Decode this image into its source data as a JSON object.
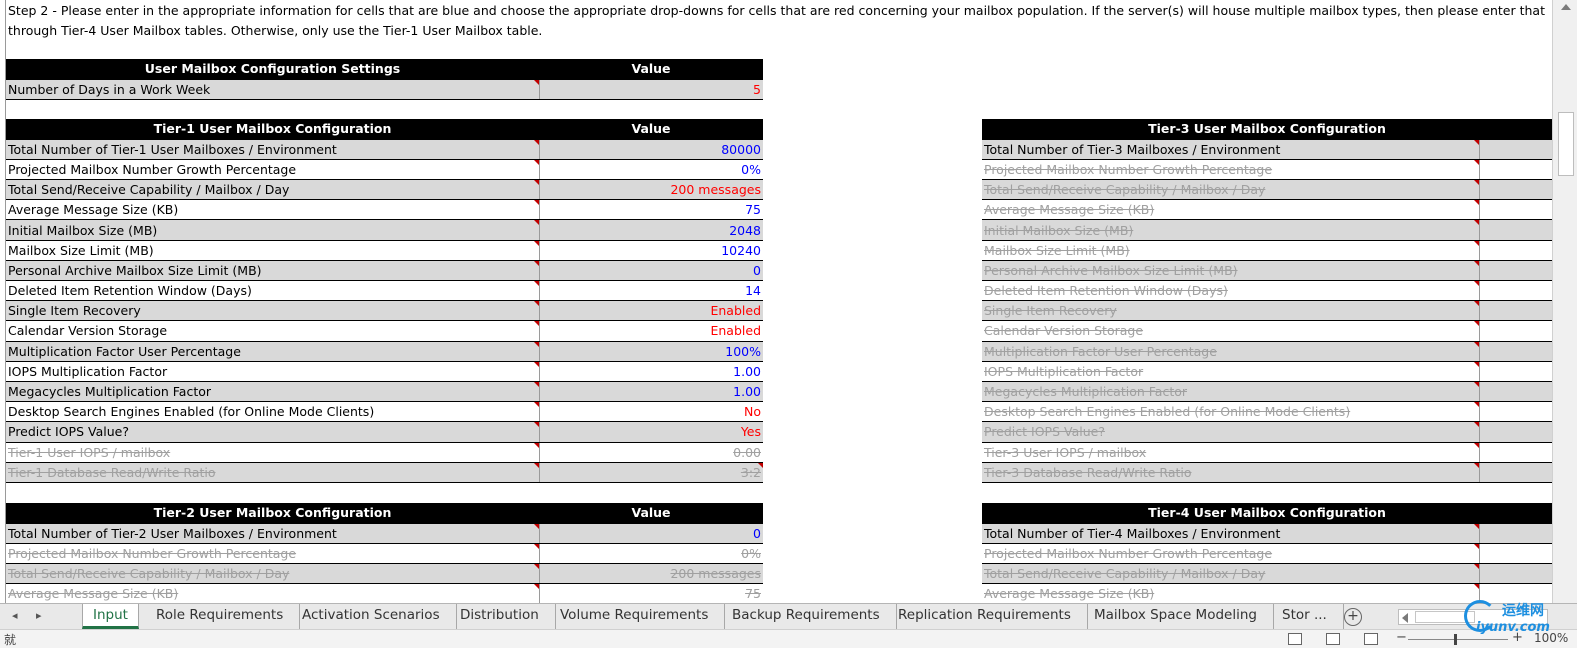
{
  "instructions": {
    "line1": "Step 2 - Please enter in the appropriate information for cells that are blue and choose the appropriate drop-downs for cells that are red concerning your mailbox population.  If the server(s) will house multiple mailbox types, then please enter that information",
    "line2": "through Tier-4 User Mailbox tables.  Otherwise, only use the Tier-1 User Mailbox table."
  },
  "settings": {
    "header": "User Mailbox Configuration Settings",
    "value_header": "Value",
    "rows": [
      {
        "label": "Number of Days in a Work Week",
        "value": "5",
        "color": "red"
      }
    ]
  },
  "tier1": {
    "header": "Tier-1 User Mailbox Configuration",
    "value_header": "Value",
    "rows": [
      {
        "label": "Total Number of Tier-1 User Mailboxes / Environment",
        "value": "80000",
        "color": "blue"
      },
      {
        "label": "Projected Mailbox Number Growth Percentage",
        "value": "0%",
        "color": "blue"
      },
      {
        "label": "Total Send/Receive Capability / Mailbox / Day",
        "value": "200 messages",
        "color": "red"
      },
      {
        "label": "Average Message Size (KB)",
        "value": "75",
        "color": "blue"
      },
      {
        "label": "Initial Mailbox Size (MB)",
        "value": "2048",
        "color": "blue"
      },
      {
        "label": "Mailbox Size Limit (MB)",
        "value": "10240",
        "color": "blue"
      },
      {
        "label": "Personal Archive Mailbox Size Limit (MB)",
        "value": "0",
        "color": "blue"
      },
      {
        "label": "Deleted Item Retention Window (Days)",
        "value": "14",
        "color": "blue"
      },
      {
        "label": "Single Item Recovery",
        "value": "Enabled",
        "color": "red"
      },
      {
        "label": "Calendar Version Storage",
        "value": "Enabled",
        "color": "red"
      },
      {
        "label": "Multiplication Factor User Percentage",
        "value": "100%",
        "color": "blue"
      },
      {
        "label": "IOPS Multiplication Factor",
        "value": "1.00",
        "color": "blue"
      },
      {
        "label": "Megacycles Multiplication Factor",
        "value": "1.00",
        "color": "blue"
      },
      {
        "label": "Desktop Search Engines Enabled (for Online Mode Clients)",
        "value": "No",
        "color": "red"
      },
      {
        "label": "Predict IOPS Value?",
        "value": "Yes",
        "color": "red"
      },
      {
        "label": "Tier-1 User IOPS / mailbox",
        "value": "0.00",
        "color": "struck"
      },
      {
        "label": "Tier-1 Database Read/Write Ratio",
        "value": "3:2",
        "color": "struck"
      }
    ]
  },
  "tier2": {
    "header": "Tier-2 User Mailbox Configuration",
    "value_header": "Value",
    "rows": [
      {
        "label": "Total Number of Tier-2 User Mailboxes / Environment",
        "value": "0",
        "color": "blue"
      },
      {
        "label": "Projected Mailbox Number Growth Percentage",
        "value": "0%",
        "color": "struck"
      },
      {
        "label": "Total Send/Receive Capability / Mailbox / Day",
        "value": "200 messages",
        "color": "struck"
      },
      {
        "label": "Average Message Size (KB)",
        "value": "75",
        "color": "struck"
      }
    ]
  },
  "tier3": {
    "header": "Tier-3 User Mailbox Configuration",
    "rows": [
      {
        "label": "Total Number of Tier-3 Mailboxes / Environment",
        "color": "normal"
      },
      {
        "label": "Projected Mailbox Number Growth Percentage",
        "color": "struck"
      },
      {
        "label": "Total Send/Receive Capability / Mailbox / Day",
        "color": "struck"
      },
      {
        "label": "Average Message Size (KB)",
        "color": "struck"
      },
      {
        "label": "Initial Mailbox Size (MB)",
        "color": "struck"
      },
      {
        "label": "Mailbox Size Limit (MB)",
        "color": "struck"
      },
      {
        "label": "Personal Archive Mailbox Size Limit (MB)",
        "color": "struck"
      },
      {
        "label": "Deleted Item Retention Window (Days)",
        "color": "struck"
      },
      {
        "label": "Single Item Recovery",
        "color": "struck"
      },
      {
        "label": "Calendar Version Storage",
        "color": "struck"
      },
      {
        "label": "Multiplication Factor User Percentage",
        "color": "struck"
      },
      {
        "label": "IOPS Multiplication Factor",
        "color": "struck"
      },
      {
        "label": "Megacycles Multiplication Factor",
        "color": "struck"
      },
      {
        "label": "Desktop Search Engines Enabled (for Online Mode Clients)",
        "color": "struck"
      },
      {
        "label": "Predict IOPS Value?",
        "color": "struck"
      },
      {
        "label": "Tier-3 User IOPS / mailbox",
        "color": "struck"
      },
      {
        "label": "Tier-3 Database Read/Write Ratio",
        "color": "struck"
      }
    ]
  },
  "tier4": {
    "header": "Tier-4 User Mailbox Configuration",
    "rows": [
      {
        "label": "Total Number of Tier-4 Mailboxes / Environment",
        "color": "normal"
      },
      {
        "label": "Projected Mailbox Number Growth Percentage",
        "color": "struck"
      },
      {
        "label": "Total Send/Receive Capability / Mailbox / Day",
        "color": "struck"
      },
      {
        "label": "Average Message Size (KB)",
        "color": "struck"
      }
    ]
  },
  "tabs": [
    {
      "label": "Input",
      "active": true
    },
    {
      "label": "Role Requirements"
    },
    {
      "label": "Activation Scenarios"
    },
    {
      "label": "Distribution"
    },
    {
      "label": "Volume Requirements"
    },
    {
      "label": "Backup Requirements"
    },
    {
      "label": "Replication Requirements"
    },
    {
      "label": "Mailbox Space Modeling"
    },
    {
      "label": "Stor ..."
    }
  ],
  "status": {
    "ready": "就",
    "zoom": "100%"
  },
  "watermark": {
    "cn": "运维网",
    "en": "iyunv.com"
  },
  "icons": {
    "nav_next": "triangle-right-icon",
    "add_sheet": "plus-circle-icon",
    "normal_view": "grid-icon",
    "page_layout": "page-icon",
    "page_break": "page-break-icon"
  }
}
